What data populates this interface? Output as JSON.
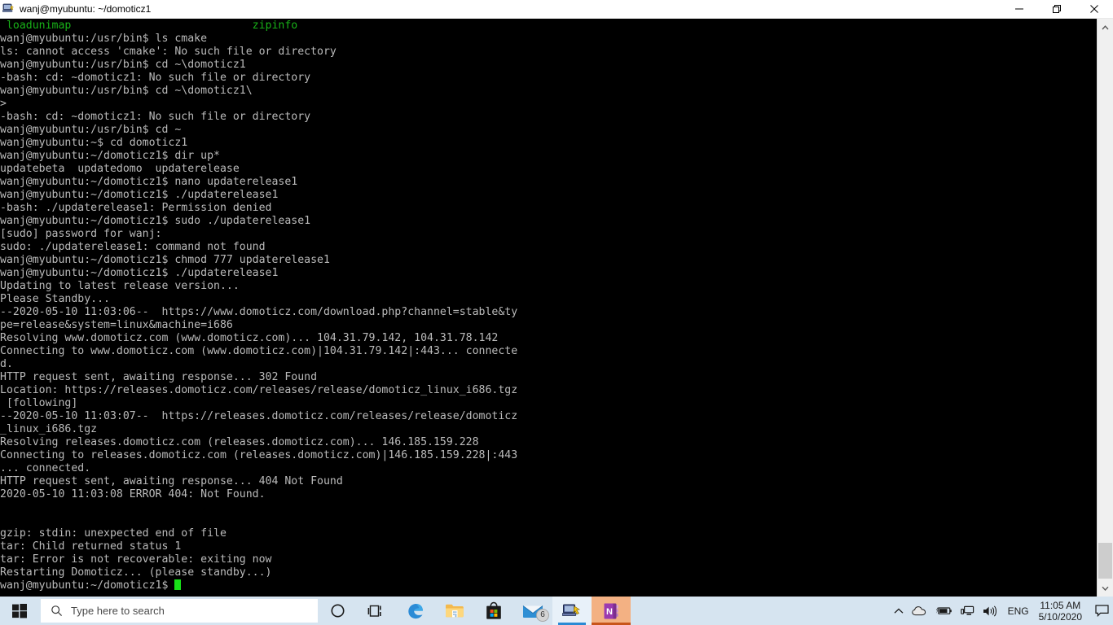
{
  "window": {
    "title": "wanj@myubuntu: ~/domoticz1",
    "icon": "putty-icon",
    "buttons": {
      "minimize": "─",
      "restore": "❐",
      "close": "✕"
    }
  },
  "terminal": {
    "colors": {
      "background": "#000000",
      "foreground": "#bbbbbb",
      "green": "#18b218",
      "cursor": "#18e018"
    },
    "header_left": "loadunimap",
    "header_right": "zipinfo",
    "lines": [
      "wanj@myubuntu:/usr/bin$ ls cmake",
      "ls: cannot access 'cmake': No such file or directory",
      "wanj@myubuntu:/usr/bin$ cd ~\\domoticz1",
      "-bash: cd: ~domoticz1: No such file or directory",
      "wanj@myubuntu:/usr/bin$ cd ~\\domoticz1\\",
      ">",
      "-bash: cd: ~domoticz1: No such file or directory",
      "wanj@myubuntu:/usr/bin$ cd ~",
      "wanj@myubuntu:~$ cd domoticz1",
      "wanj@myubuntu:~/domoticz1$ dir up*",
      "updatebeta  updatedomo  updaterelease",
      "wanj@myubuntu:~/domoticz1$ nano updaterelease1",
      "wanj@myubuntu:~/domoticz1$ ./updaterelease1",
      "-bash: ./updaterelease1: Permission denied",
      "wanj@myubuntu:~/domoticz1$ sudo ./updaterelease1",
      "[sudo] password for wanj:",
      "sudo: ./updaterelease1: command not found",
      "wanj@myubuntu:~/domoticz1$ chmod 777 updaterelease1",
      "wanj@myubuntu:~/domoticz1$ ./updaterelease1",
      "Updating to latest release version...",
      "Please Standby...",
      "--2020-05-10 11:03:06--  https://www.domoticz.com/download.php?channel=stable&ty",
      "pe=release&system=linux&machine=i686",
      "Resolving www.domoticz.com (www.domoticz.com)... 104.31.79.142, 104.31.78.142",
      "Connecting to www.domoticz.com (www.domoticz.com)|104.31.79.142|:443... connecte",
      "d.",
      "HTTP request sent, awaiting response... 302 Found",
      "Location: https://releases.domoticz.com/releases/release/domoticz_linux_i686.tgz",
      " [following]",
      "--2020-05-10 11:03:07--  https://releases.domoticz.com/releases/release/domoticz",
      "_linux_i686.tgz",
      "Resolving releases.domoticz.com (releases.domoticz.com)... 146.185.159.228",
      "Connecting to releases.domoticz.com (releases.domoticz.com)|146.185.159.228|:443",
      "... connected.",
      "HTTP request sent, awaiting response... 404 Not Found",
      "2020-05-10 11:03:08 ERROR 404: Not Found.",
      "",
      "",
      "gzip: stdin: unexpected end of file",
      "tar: Child returned status 1",
      "tar: Error is not recoverable: exiting now",
      "Restarting Domoticz... (please standby...)"
    ],
    "prompt": "wanj@myubuntu:~/domoticz1$ "
  },
  "scrollbar": {
    "up_arrow": "∧",
    "down_arrow": "∨"
  },
  "taskbar": {
    "start_label": "start-button",
    "search": {
      "placeholder": "Type here to search",
      "icon": "search-icon"
    },
    "apps": [
      {
        "name": "cortana-icon",
        "label": "Cortana",
        "state": "normal"
      },
      {
        "name": "task-view-icon",
        "label": "Task View",
        "state": "normal"
      },
      {
        "name": "edge-icon",
        "label": "Microsoft Edge",
        "state": "normal"
      },
      {
        "name": "file-explorer-icon",
        "label": "File Explorer",
        "state": "normal"
      },
      {
        "name": "microsoft-store-icon",
        "label": "Microsoft Store",
        "state": "normal"
      },
      {
        "name": "mail-icon",
        "label": "Mail",
        "state": "normal",
        "badge": "6"
      },
      {
        "name": "putty-icon",
        "label": "PuTTY",
        "state": "active"
      },
      {
        "name": "onenote-icon",
        "label": "OneNote",
        "state": "pinned-open"
      }
    ],
    "tray": {
      "show_hidden": "∧",
      "onedrive": "onedrive-icon",
      "battery": "battery-charging-icon",
      "network": "network-icon",
      "volume": "volume-icon",
      "language": "ENG",
      "time": "11:05 AM",
      "date": "5/10/2020",
      "action_center": "action-center-icon"
    }
  }
}
